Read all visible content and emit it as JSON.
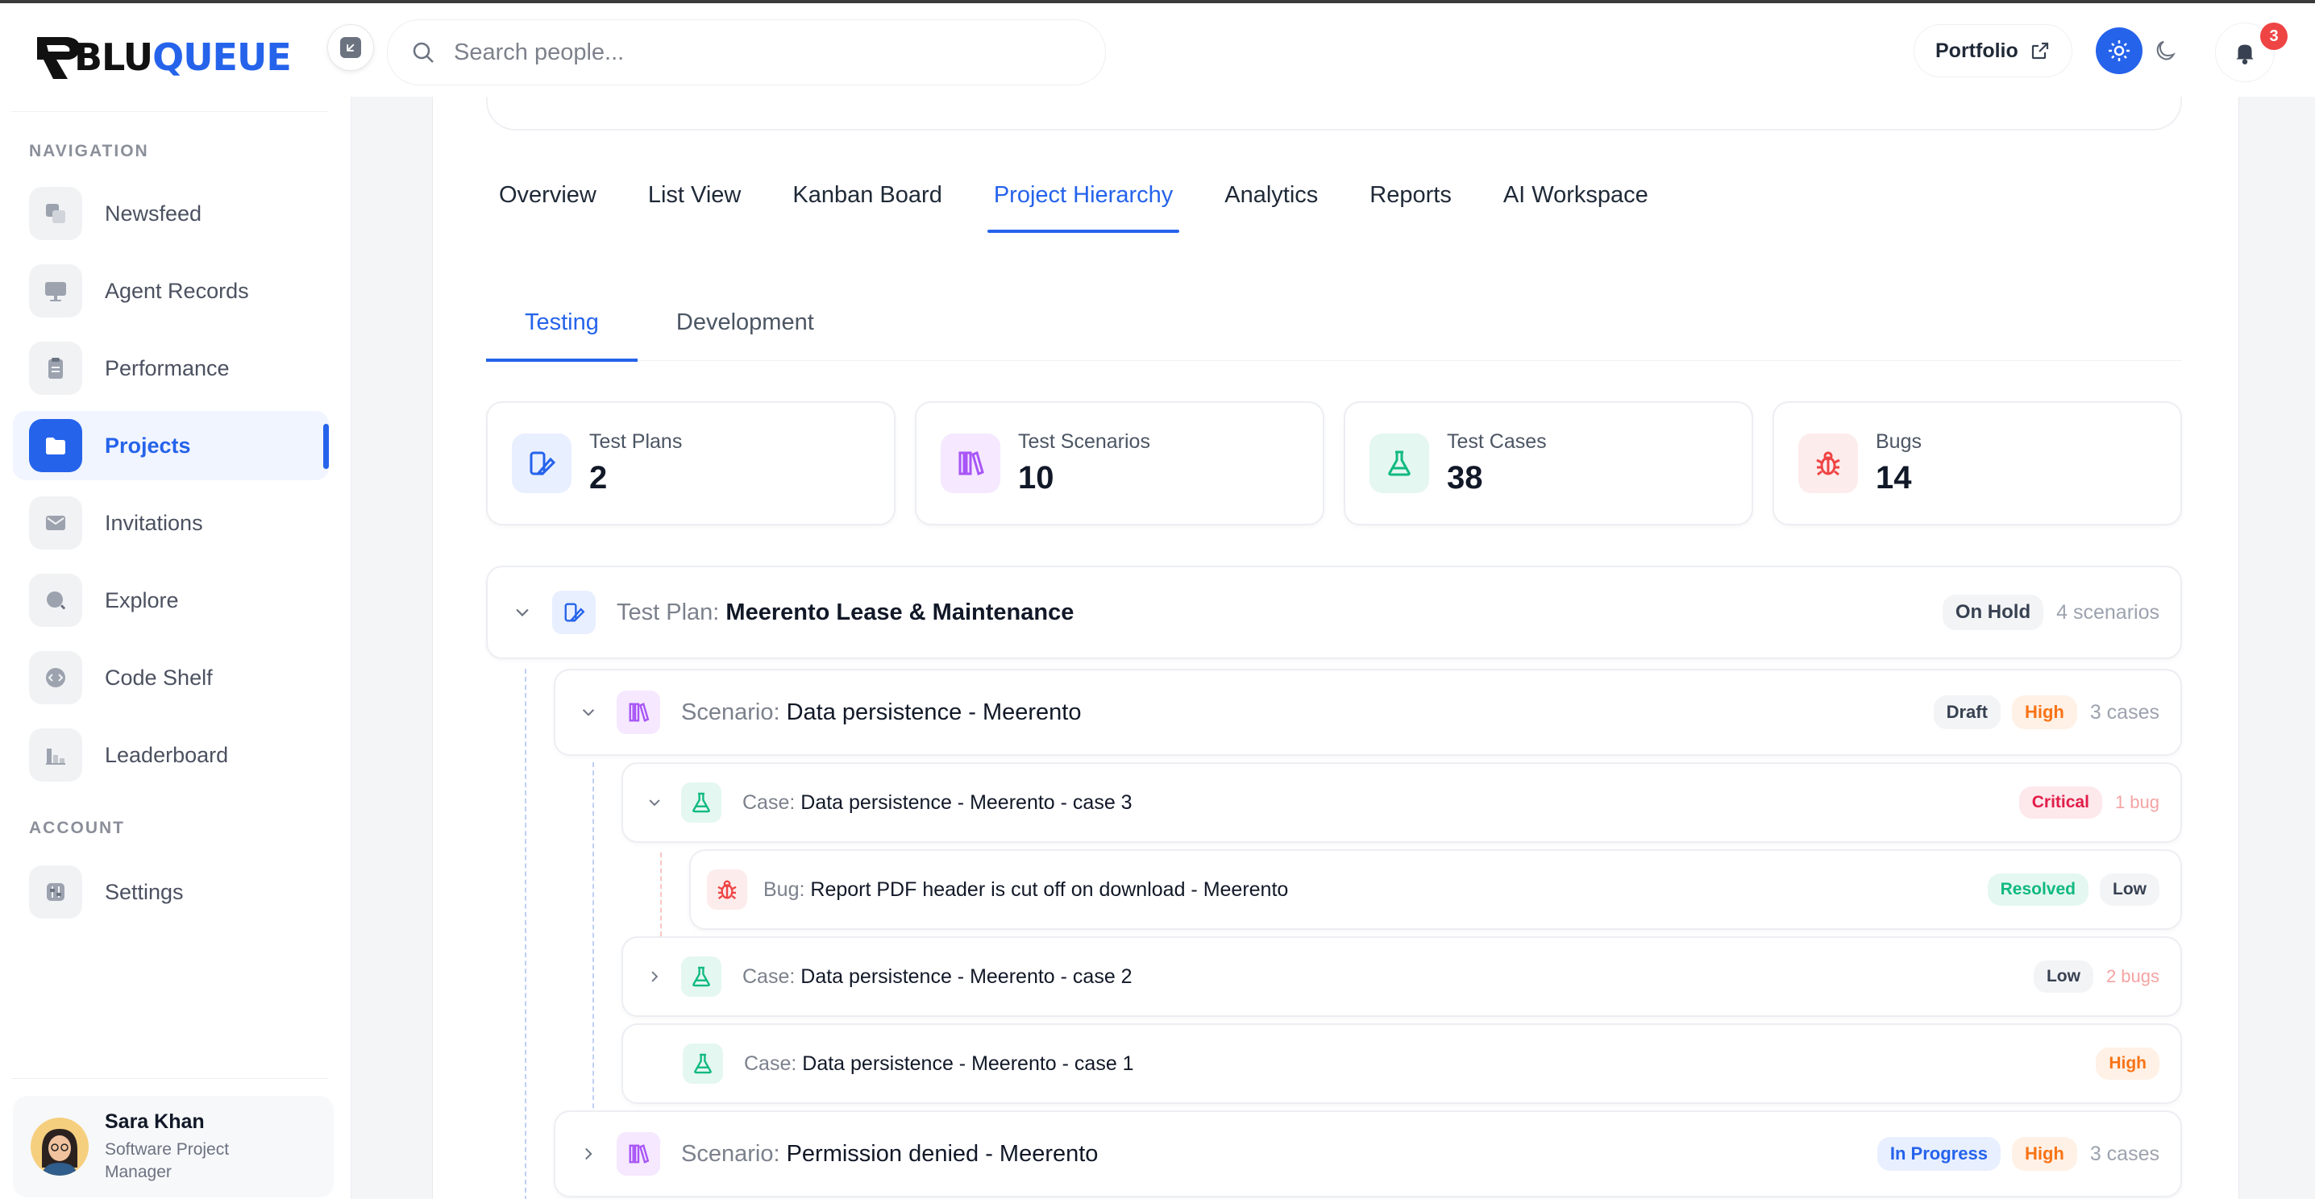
{
  "brand": {
    "name_dark": "BLU",
    "name_blue": "QUEUE"
  },
  "search": {
    "placeholder": "Search people..."
  },
  "header": {
    "portfolio_label": "Portfolio",
    "notification_count": "3"
  },
  "sidebar": {
    "nav_heading": "NAVIGATION",
    "account_heading": "ACCOUNT",
    "items": [
      {
        "label": "Newsfeed",
        "icon": "newsfeed-icon"
      },
      {
        "label": "Agent Records",
        "icon": "monitor-icon"
      },
      {
        "label": "Performance",
        "icon": "clipboard-icon"
      },
      {
        "label": "Projects",
        "icon": "folder-icon"
      },
      {
        "label": "Invitations",
        "icon": "mail-icon"
      },
      {
        "label": "Explore",
        "icon": "explore-icon"
      },
      {
        "label": "Code Shelf",
        "icon": "code-icon"
      },
      {
        "label": "Leaderboard",
        "icon": "leaderboard-icon"
      }
    ],
    "account_items": [
      {
        "label": "Settings",
        "icon": "settings-icon"
      }
    ],
    "active": "Projects"
  },
  "profile": {
    "name": "Sara Khan",
    "role": "Software Project Manager"
  },
  "tabs": [
    "Overview",
    "List View",
    "Kanban Board",
    "Project Hierarchy",
    "Analytics",
    "Reports",
    "AI Workspace"
  ],
  "active_tab": "Project Hierarchy",
  "subtabs": [
    "Testing",
    "Development"
  ],
  "active_subtab": "Testing",
  "stats": [
    {
      "label": "Test Plans",
      "value": "2"
    },
    {
      "label": "Test Scenarios",
      "value": "10"
    },
    {
      "label": "Test Cases",
      "value": "38"
    },
    {
      "label": "Bugs",
      "value": "14"
    }
  ],
  "hierarchy": {
    "plan": {
      "prefix": "Test Plan:",
      "name": "Meerento Lease & Maintenance",
      "status": "On Hold",
      "count": "4 scenarios"
    },
    "scenario1": {
      "prefix": "Scenario:",
      "name": "Data persistence - Meerento",
      "status": "Draft",
      "priority": "High",
      "count": "3 cases"
    },
    "case3": {
      "prefix": "Case:",
      "name": "Data persistence - Meerento - case 3",
      "priority": "Critical",
      "count": "1 bug"
    },
    "bug1": {
      "prefix": "Bug:",
      "name": "Report PDF header is cut off on download - Meerento",
      "status": "Resolved",
      "priority": "Low"
    },
    "case2": {
      "prefix": "Case:",
      "name": "Data persistence - Meerento - case 2",
      "priority": "Low",
      "count": "2 bugs"
    },
    "case1": {
      "prefix": "Case:",
      "name": "Data persistence - Meerento - case 1",
      "priority": "High"
    },
    "scenario2": {
      "prefix": "Scenario:",
      "name": "Permission denied - Meerento",
      "status": "In Progress",
      "priority": "High",
      "count": "3 cases"
    }
  },
  "colors": {
    "accent": "#2563eb",
    "critical": "#e11d48",
    "high": "#f97316",
    "resolved": "#10b981"
  }
}
